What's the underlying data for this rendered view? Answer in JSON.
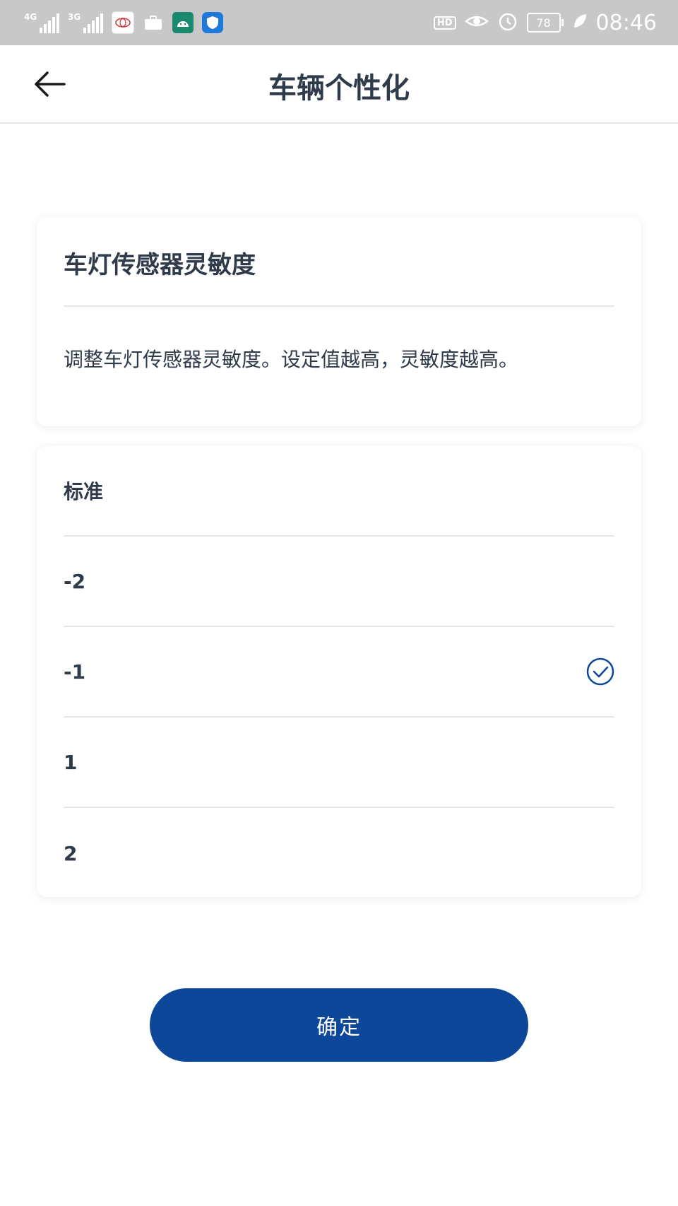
{
  "status_bar": {
    "network_1": "4G",
    "network_2": "3G",
    "hd_label": "HD",
    "battery_level": "78",
    "time": "08:46"
  },
  "app_bar": {
    "title": "车辆个性化"
  },
  "info_card": {
    "heading": "车灯传感器灵敏度",
    "description": "调整车灯传感器灵敏度。设定值越高，灵敏度越高。"
  },
  "options": [
    {
      "label": "标准",
      "selected": false
    },
    {
      "label": "-2",
      "selected": false
    },
    {
      "label": "-1",
      "selected": true
    },
    {
      "label": "1",
      "selected": false
    },
    {
      "label": "2",
      "selected": false
    }
  ],
  "confirm_button": {
    "label": "确定"
  },
  "colors": {
    "accent": "#0d4799",
    "text": "#2f3a4a",
    "divider": "#e4e6ea",
    "status_bar": "#c8c8c8"
  }
}
